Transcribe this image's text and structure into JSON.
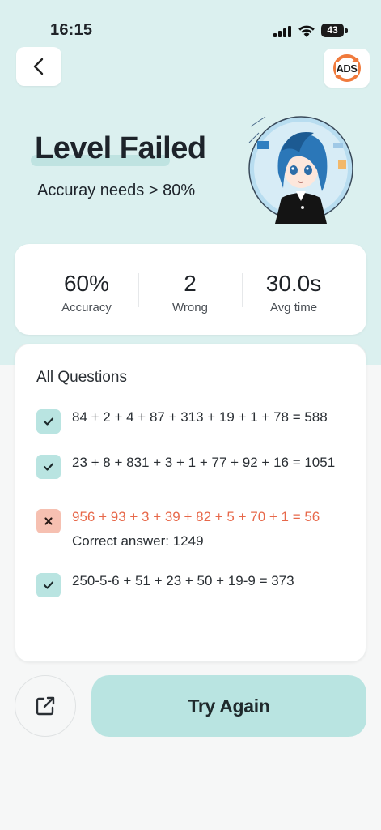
{
  "status_bar": {
    "time": "16:15",
    "battery": "43"
  },
  "header": {
    "ads_label": "ADS"
  },
  "result": {
    "title": "Level Failed",
    "subtitle": "Accuray needs > 80%"
  },
  "stats": [
    {
      "value": "60%",
      "label": "Accuracy"
    },
    {
      "value": "2",
      "label": "Wrong"
    },
    {
      "value": "30.0s",
      "label": "Avg time"
    }
  ],
  "questions": {
    "heading": "All Questions",
    "items": [
      {
        "expression": "84 + 2 + 4 + 87 + 313 + 19 + 1 + 78 = 588",
        "status": "correct"
      },
      {
        "expression": "23 + 8 + 831 + 3 + 1 + 77 + 92 + 16 = 1051",
        "status": "correct"
      },
      {
        "expression": "956 + 93 + 3 + 39 + 82 + 5 + 70 + 1 = 56",
        "status": "wrong",
        "correct_answer": "Correct answer: 1249"
      },
      {
        "expression": "250-5-6 + 51 + 23 + 50 + 19-9 = 373",
        "status": "correct"
      }
    ]
  },
  "actions": {
    "try_again_label": "Try Again"
  },
  "colors": {
    "accent": "#b9e4e1",
    "header_bg": "#dbf0ef",
    "error": "#e7684a",
    "error_badge": "#f6c0b1"
  }
}
